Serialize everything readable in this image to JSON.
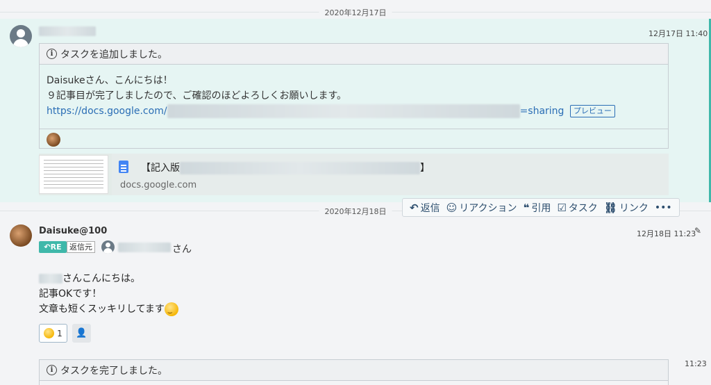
{
  "dates": {
    "first": "2020年12月17日",
    "second": "2020年12月18日"
  },
  "message1": {
    "time": "12月17日 11:40",
    "task_header": "タスクを追加しました。",
    "body_line1": "Daisukeさん、こんにちは！",
    "body_line2": "９記事目が完了しましたので、ご確認のほどよろしくお願いします。",
    "link_start": "https://docs.google.com/",
    "link_end": "=sharing",
    "preview_label": "プレビュー",
    "card": {
      "title_prefix": "【記入版",
      "title_suffix": "】",
      "domain": "docs.google.com"
    }
  },
  "actions": {
    "reply": "返信",
    "reaction": "リアクション",
    "quote": "引用",
    "task": "タスク",
    "link": "リンク",
    "more": "•••"
  },
  "message2": {
    "sender": "Daisuke@100",
    "time": "12月18日 11:23",
    "re_badge": "RE",
    "reply_source": "返信元",
    "to_suffix": "さん",
    "line1": "さんこんにちは。",
    "line2": "記事OKです！",
    "line3": "文章も短くスッキリしてます",
    "reaction_count": "1"
  },
  "message3": {
    "time": "11:23",
    "task_header": "タスクを完了しました。"
  },
  "colors": {
    "accent": "#3fb8aa",
    "link": "#2a6db5",
    "highlight_bg": "#e6f5f3"
  }
}
